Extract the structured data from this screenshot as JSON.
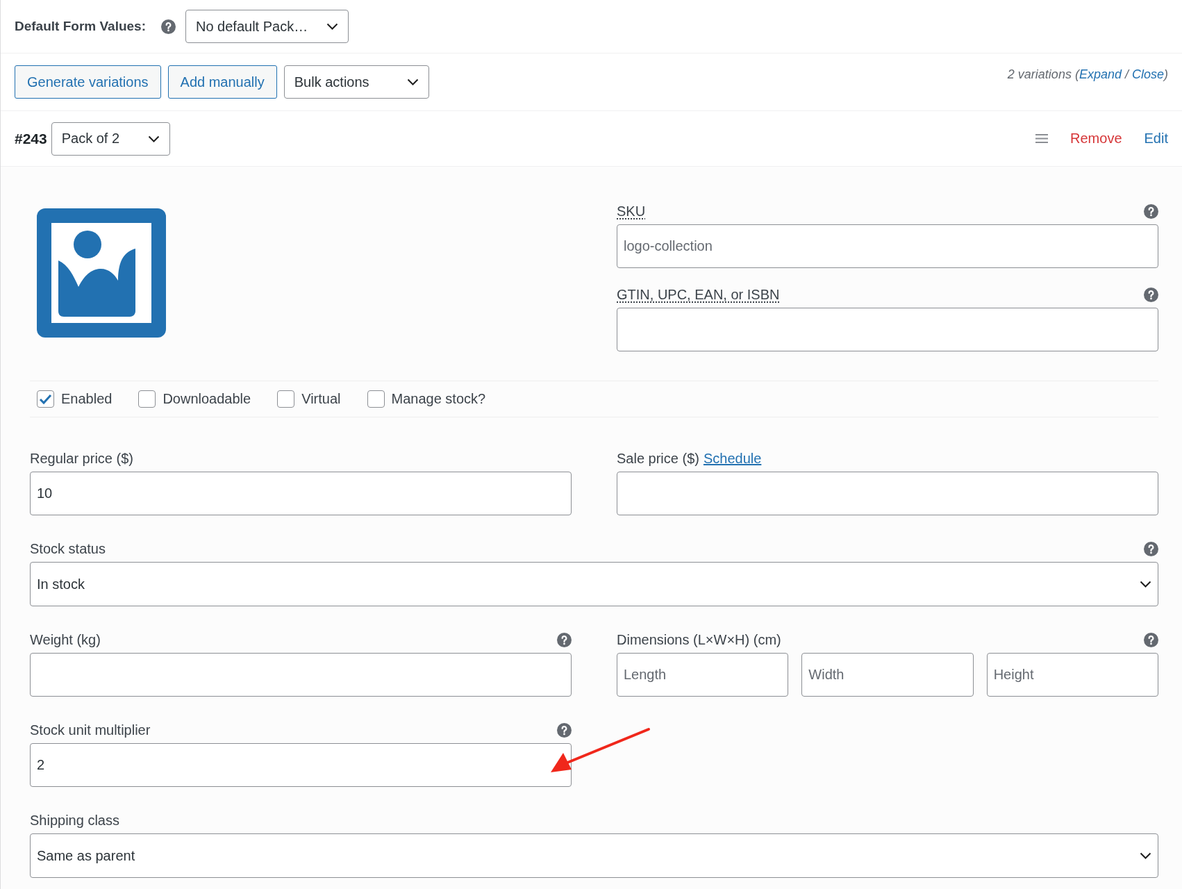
{
  "default_values": {
    "label": "Default Form Values:",
    "help": true,
    "select": "No default Pack…"
  },
  "toolbar": {
    "buttons": [
      "Generate variations",
      "Add manually"
    ],
    "bulk_actions": "Bulk actions",
    "summary": {
      "prefix": "2 variations (",
      "expand": "Expand",
      "separator": " / ",
      "close": "Close",
      "suffix": ")"
    }
  },
  "variation": {
    "id": "#243",
    "attribute": "Pack of 2",
    "remove": "Remove",
    "edit": "Edit",
    "image_fields": [
      {
        "label": "SKU",
        "placeholder": "logo-collection",
        "help": true
      },
      {
        "label": "GTIN, UPC, EAN, or ISBN",
        "help": true
      }
    ],
    "options": [
      {
        "label": "Enabled",
        "checked": true
      },
      {
        "label": "Downloadable",
        "checked": false
      },
      {
        "label": "Virtual",
        "checked": false
      },
      {
        "label": "Manage stock?",
        "checked": false
      }
    ],
    "rows": [
      [
        {
          "kind": "input",
          "label": "Regular price ($)",
          "value": "10",
          "help": false
        },
        {
          "kind": "input",
          "label": "Sale price ($)",
          "link": "Schedule",
          "help": false
        }
      ],
      [
        {
          "kind": "select",
          "label": "Stock status",
          "value": "In stock",
          "help": true
        }
      ],
      [
        {
          "kind": "input",
          "label": "Weight (kg)",
          "help": true
        },
        {
          "kind": "dimensions",
          "label": "Dimensions (L×W×H) (cm)",
          "help": true,
          "inputs": [
            {
              "placeholder": "Length"
            },
            {
              "placeholder": "Width"
            },
            {
              "placeholder": "Height"
            }
          ]
        }
      ],
      [
        {
          "kind": "input",
          "label": "Stock unit multiplier",
          "value": "2",
          "help": true
        }
      ],
      [
        {
          "kind": "select",
          "label": "Shipping class",
          "value": "Same as parent",
          "help": false
        }
      ]
    ]
  }
}
